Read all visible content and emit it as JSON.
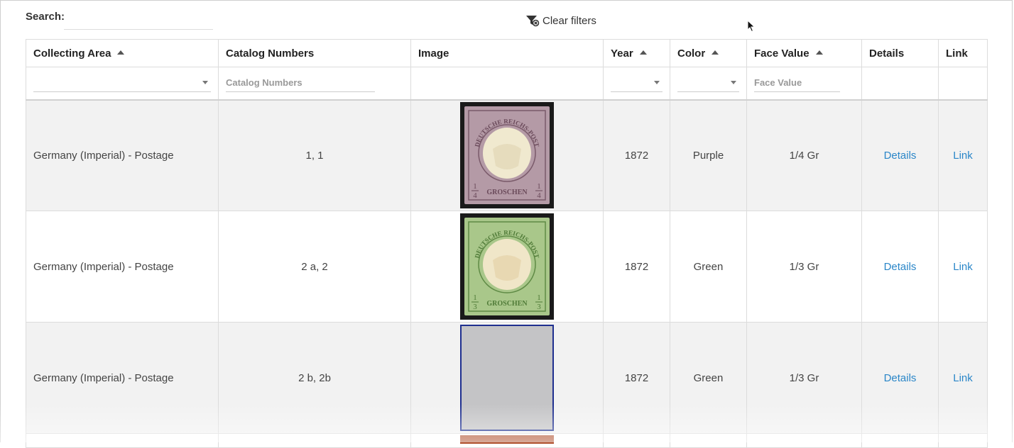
{
  "search": {
    "label": "Search:",
    "value": "",
    "placeholder": ""
  },
  "toolbar": {
    "clear_filters_label": "Clear filters"
  },
  "table": {
    "columns": {
      "collecting_area": "Collecting Area",
      "catalog_numbers": "Catalog Numbers",
      "image": "Image",
      "year": "Year",
      "color": "Color",
      "face_value": "Face Value",
      "details": "Details",
      "link": "Link"
    },
    "filters": {
      "catalog_numbers_placeholder": "Catalog Numbers",
      "face_value_placeholder": "Face Value"
    },
    "rows": [
      {
        "collecting_area": "Germany (Imperial) - Postage",
        "catalog_numbers": "1, 1",
        "year": "1872",
        "color": "Purple",
        "face_value": "1/4 Gr",
        "details": "Details",
        "link": "Link",
        "stamp_top_text": "DEUTSCHE REICHS-POST",
        "stamp_bottom_text": "GROSCHEN",
        "stamp_fraction_num": "1",
        "stamp_fraction_den": "4"
      },
      {
        "collecting_area": "Germany (Imperial) - Postage",
        "catalog_numbers": "2 a, 2",
        "year": "1872",
        "color": "Green",
        "face_value": "1/3 Gr",
        "details": "Details",
        "link": "Link",
        "stamp_top_text": "DEUTSCHE REICHS-POST",
        "stamp_bottom_text": "GROSCHEN",
        "stamp_fraction_num": "1",
        "stamp_fraction_den": "3"
      },
      {
        "collecting_area": "Germany (Imperial) - Postage",
        "catalog_numbers": "2 b, 2b",
        "year": "1872",
        "color": "Green",
        "face_value": "1/3 Gr",
        "details": "Details",
        "link": "Link"
      }
    ]
  },
  "colors": {
    "link": "#2a86c8",
    "stamp_purple": "#b49aa6",
    "stamp_green": "#a9c78a",
    "placeholder_border": "#1e2f8f"
  }
}
